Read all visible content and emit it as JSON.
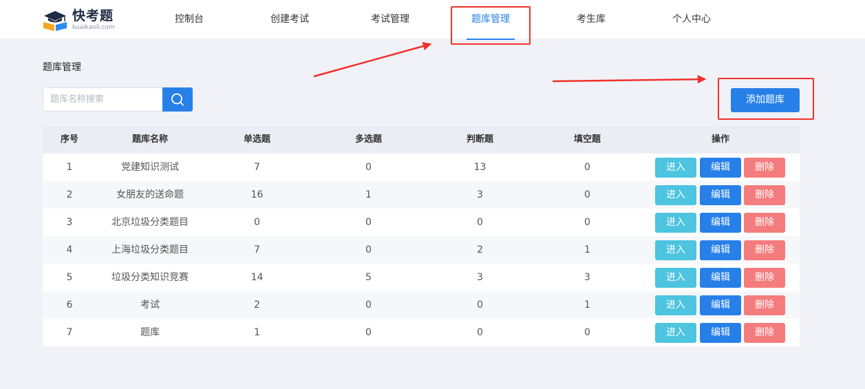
{
  "logo": {
    "brand": "快考题",
    "domain": "kuaikaoli.com"
  },
  "nav": [
    {
      "label": "控制台"
    },
    {
      "label": "创建考试"
    },
    {
      "label": "考试管理"
    },
    {
      "label": "题库管理",
      "active": true
    },
    {
      "label": "考生库"
    },
    {
      "label": "个人中心"
    }
  ],
  "page": {
    "title": "题库管理"
  },
  "search": {
    "placeholder": "题库名称搜索",
    "value": ""
  },
  "add_button": "添加题库",
  "table": {
    "headers": [
      "序号",
      "题库名称",
      "单选题",
      "多选题",
      "判断题",
      "填空题",
      "操作"
    ],
    "rows": [
      [
        "1",
        "党建知识测试",
        "7",
        "0",
        "13",
        "0"
      ],
      [
        "2",
        "女朋友的送命题",
        "16",
        "1",
        "3",
        "0"
      ],
      [
        "3",
        "北京垃圾分类题目",
        "0",
        "0",
        "0",
        "0"
      ],
      [
        "4",
        "上海垃圾分类题目",
        "7",
        "0",
        "2",
        "1"
      ],
      [
        "5",
        "垃圾分类知识竞赛",
        "14",
        "5",
        "3",
        "3"
      ],
      [
        "6",
        "考试",
        "2",
        "0",
        "0",
        "1"
      ],
      [
        "7",
        "题库",
        "1",
        "0",
        "0",
        "0"
      ]
    ],
    "actions": {
      "enter": "进入",
      "edit": "编辑",
      "delete": "删除"
    }
  },
  "colors": {
    "primary": "#2780e8",
    "enter": "#4dc4e0",
    "delete": "#f47c7c",
    "annotation": "#f0302c",
    "background": "#f0f2f7"
  }
}
